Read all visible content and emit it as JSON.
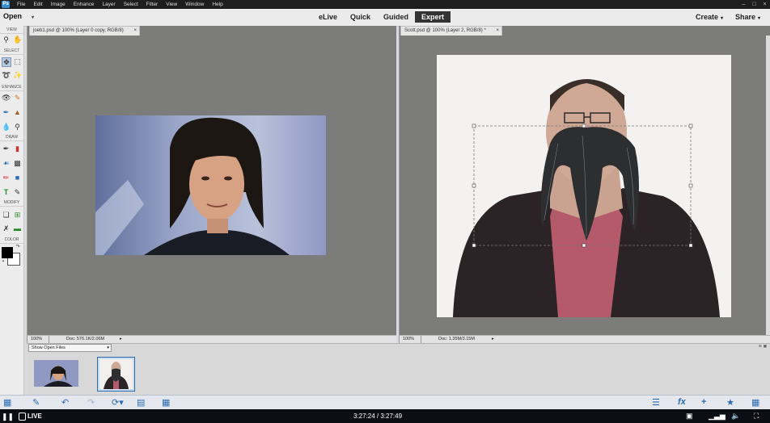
{
  "menubar": {
    "items": [
      "File",
      "Edit",
      "Image",
      "Enhance",
      "Layer",
      "Select",
      "Filter",
      "View",
      "Window",
      "Help"
    ]
  },
  "modebar": {
    "open_label": "Open",
    "modes": [
      "eLive",
      "Quick",
      "Guided",
      "Expert"
    ],
    "active_mode": "Expert",
    "create_label": "Create",
    "share_label": "Share"
  },
  "toolbox": {
    "sections": [
      "VIEW",
      "SELECT",
      "ENHANCE",
      "DRAW",
      "MODIFY",
      "COLOR"
    ],
    "tools": [
      "zoom-tool",
      "hand-tool",
      "move-tool",
      "marquee-tool",
      "lasso-tool",
      "magic-wand-tool",
      "red-eye-tool",
      "spot-healing-tool",
      "smart-brush-tool",
      "clone-stamp-tool",
      "blur-tool",
      "sponge-tool",
      "brush-tool",
      "eraser-tool",
      "paint-bucket-tool",
      "gradient-tool",
      "color-picker-tool",
      "shape-tool",
      "type-tool",
      "pencil-tool",
      "crop-tool",
      "recompose-tool",
      "straighten-tool",
      "content-aware-move-tool"
    ],
    "foreground_color": "#000000",
    "background_color": "#ffffff"
  },
  "documents": [
    {
      "tab_title": "joeb1.psd @ 100% (Layer 0 copy, RGB/8)",
      "zoom": "100%",
      "doc_size": "Doc: 576.1K/2.06M"
    },
    {
      "tab_title": "Scott.psd @ 100% (Layer 2, RGB/8) *",
      "zoom": "100%",
      "doc_size": "Doc: 1.35M/3.15M"
    }
  ],
  "photo_bin": {
    "select_label": "Show Open Files",
    "thumbnails": [
      "joeb1.psd",
      "Scott.psd"
    ],
    "selected_index": 1
  },
  "bottom_bar": {
    "icons": [
      "photo-bin-icon",
      "tool-options-icon",
      "undo-icon",
      "redo-icon",
      "rotate-icon",
      "layout-icon",
      "organizer-icon",
      "layers-icon",
      "effects-icon",
      "add-icon",
      "favorites-icon",
      "more-icon"
    ]
  },
  "player": {
    "live_label": "LIVE",
    "time_label": "3:27:24 / 3:27:49"
  },
  "colors": {
    "canvas_bg": "#7c7c7a",
    "accent": "#2a6cb2",
    "active_mode_bg": "#333333"
  }
}
